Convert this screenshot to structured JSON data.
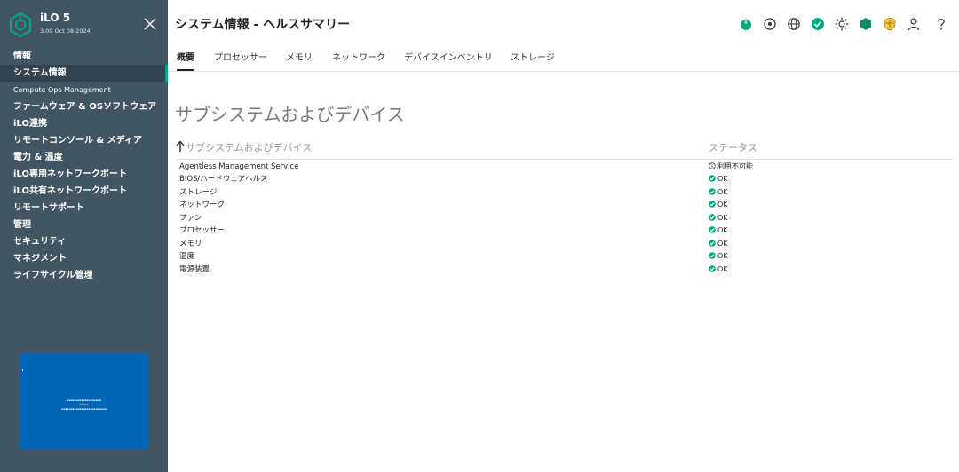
{
  "brand": {
    "name": "iLO 5",
    "version": "3.09 Oct 08 2024"
  },
  "sidebar": {
    "items": [
      {
        "label": "情報",
        "style": "normal",
        "active": false
      },
      {
        "label": "システム情報",
        "style": "normal",
        "active": true
      },
      {
        "label": "Compute Ops Management",
        "style": "small",
        "active": false
      },
      {
        "label": "ファームウェア & OSソフトウェア",
        "style": "normal",
        "active": false
      },
      {
        "label": "iLO連携",
        "style": "normal",
        "active": false
      },
      {
        "label": "リモートコンソール & メディア",
        "style": "normal",
        "active": false
      },
      {
        "label": "電力 & 温度",
        "style": "normal",
        "active": false
      },
      {
        "label": "iLO専用ネットワークポート",
        "style": "normal",
        "active": false
      },
      {
        "label": "iLO共有ネットワークポート",
        "style": "normal",
        "active": false
      },
      {
        "label": "リモートサポート",
        "style": "normal",
        "active": false
      },
      {
        "label": "管理",
        "style": "normal",
        "active": false
      },
      {
        "label": "セキュリティ",
        "style": "normal",
        "active": false
      },
      {
        "label": "マネジメント",
        "style": "normal",
        "active": false
      },
      {
        "label": "ライフサイクル管理",
        "style": "normal",
        "active": false
      }
    ]
  },
  "header": {
    "title": "システム情報 - ヘルスサマリー",
    "icons": [
      "power-icon",
      "locator-icon",
      "globe-icon",
      "health-ok-icon",
      "uid-light-icon",
      "security-shield-icon",
      "security-badge-icon",
      "user-icon",
      "help-icon"
    ]
  },
  "tabs": [
    "概要",
    "プロセッサー",
    "メモリ",
    "ネットワーク",
    "デバイスインベントリ",
    "ストレージ"
  ],
  "main": {
    "section_title": "サブシステムおよびデバイス",
    "columns": {
      "name": "サブシステムおよびデバイス",
      "status": "ステータス"
    },
    "rows": [
      {
        "name": "Agentless Management Service",
        "status": "利用不可能",
        "state": "unavailable"
      },
      {
        "name": "BIOS/ハードウェアヘルス",
        "status": "OK",
        "state": "ok"
      },
      {
        "name": "ストレージ",
        "status": "OK",
        "state": "ok"
      },
      {
        "name": "ネットワーク",
        "status": "OK",
        "state": "ok"
      },
      {
        "name": "ファン",
        "status": "OK",
        "state": "ok"
      },
      {
        "name": "プロセッサー",
        "status": "OK",
        "state": "ok"
      },
      {
        "name": "メモリ",
        "status": "OK",
        "state": "ok"
      },
      {
        "name": "温度",
        "status": "OK",
        "state": "ok"
      },
      {
        "name": "電源装置",
        "status": "OK",
        "state": "ok"
      }
    ]
  },
  "colors": {
    "sidebar_bg": "#425563",
    "accent": "#01a982",
    "status_ok": "#01a982",
    "console_bg": "#0067b8"
  }
}
